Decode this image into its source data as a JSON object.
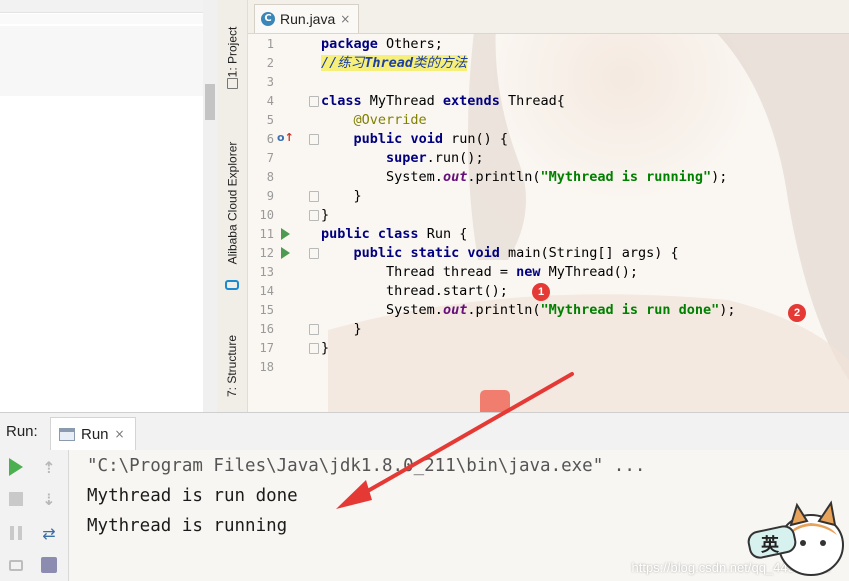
{
  "editor": {
    "tab": {
      "icon": "java-class-icon",
      "icon_letter": "C",
      "label": "Run.java",
      "close": "×"
    },
    "line_numbers": [
      "1",
      "2",
      "3",
      "4",
      "5",
      "6",
      "7",
      "8",
      "9",
      "10",
      "11",
      "12",
      "13",
      "14",
      "15",
      "16",
      "17",
      "18"
    ],
    "lines": {
      "l1": {
        "kw": "package",
        "rest": " Others;"
      },
      "l2": {
        "comment_a": "//练习",
        "comment_b": "Thread",
        "comment_c": "类的方法"
      },
      "l4": {
        "kw1": "class",
        "mid": " MyThread ",
        "kw2": "extends",
        "rest": " Thread{"
      },
      "l5": {
        "indent": "    ",
        "ann": "@Override"
      },
      "l6": {
        "indent": "    ",
        "kw1": "public",
        "sp": " ",
        "kw2": "void",
        "rest": " run() {"
      },
      "l7": {
        "indent": "        ",
        "kw": "super",
        "rest": ".run();"
      },
      "l8": {
        "indent": "        ",
        "pre": "System.",
        "field": "out",
        "mid": ".println(",
        "str": "\"Mythread is running\"",
        "end": ");"
      },
      "l9": {
        "text": "    }"
      },
      "l10": {
        "text": "}"
      },
      "l11": {
        "kw1": "public",
        "sp": " ",
        "kw2": "class",
        "rest": " Run {"
      },
      "l12": {
        "indent": "    ",
        "kw1": "public",
        "sp1": " ",
        "kw2": "static",
        "sp2": " ",
        "kw3": "void",
        "rest": " main(String[] args) {"
      },
      "l13": {
        "indent": "        ",
        "pre": "Thread thread = ",
        "kw": "new",
        "rest": " MyThread();"
      },
      "l14": {
        "text": "        thread.start();"
      },
      "l15": {
        "indent": "        ",
        "pre": "System.",
        "field": "out",
        "mid": ".println(",
        "str": "\"Mythread is run done\"",
        "end": ");"
      },
      "l16": {
        "text": "    }"
      },
      "l17": {
        "text": "}"
      }
    },
    "badges": [
      "1",
      "2"
    ]
  },
  "tool_strip": {
    "project": "1: Project",
    "cloud": "Alibaba Cloud Explorer",
    "structure": "7: Structure"
  },
  "run_panel": {
    "title": "Run:",
    "tab_label": "Run",
    "tab_close": "×",
    "console": [
      "\"C:\\Program Files\\Java\\jdk1.8.0_211\\bin\\java.exe\" ...",
      "Mythread is run done",
      "Mythread is running"
    ],
    "watermark": "https://blog.csdn.net/qq_44944910",
    "mascot_char": "英"
  },
  "colors": {
    "keyword": "#000080",
    "string": "#008000",
    "annotation": "#808000",
    "badge": "#e53935",
    "run_green": "#4caf50"
  }
}
